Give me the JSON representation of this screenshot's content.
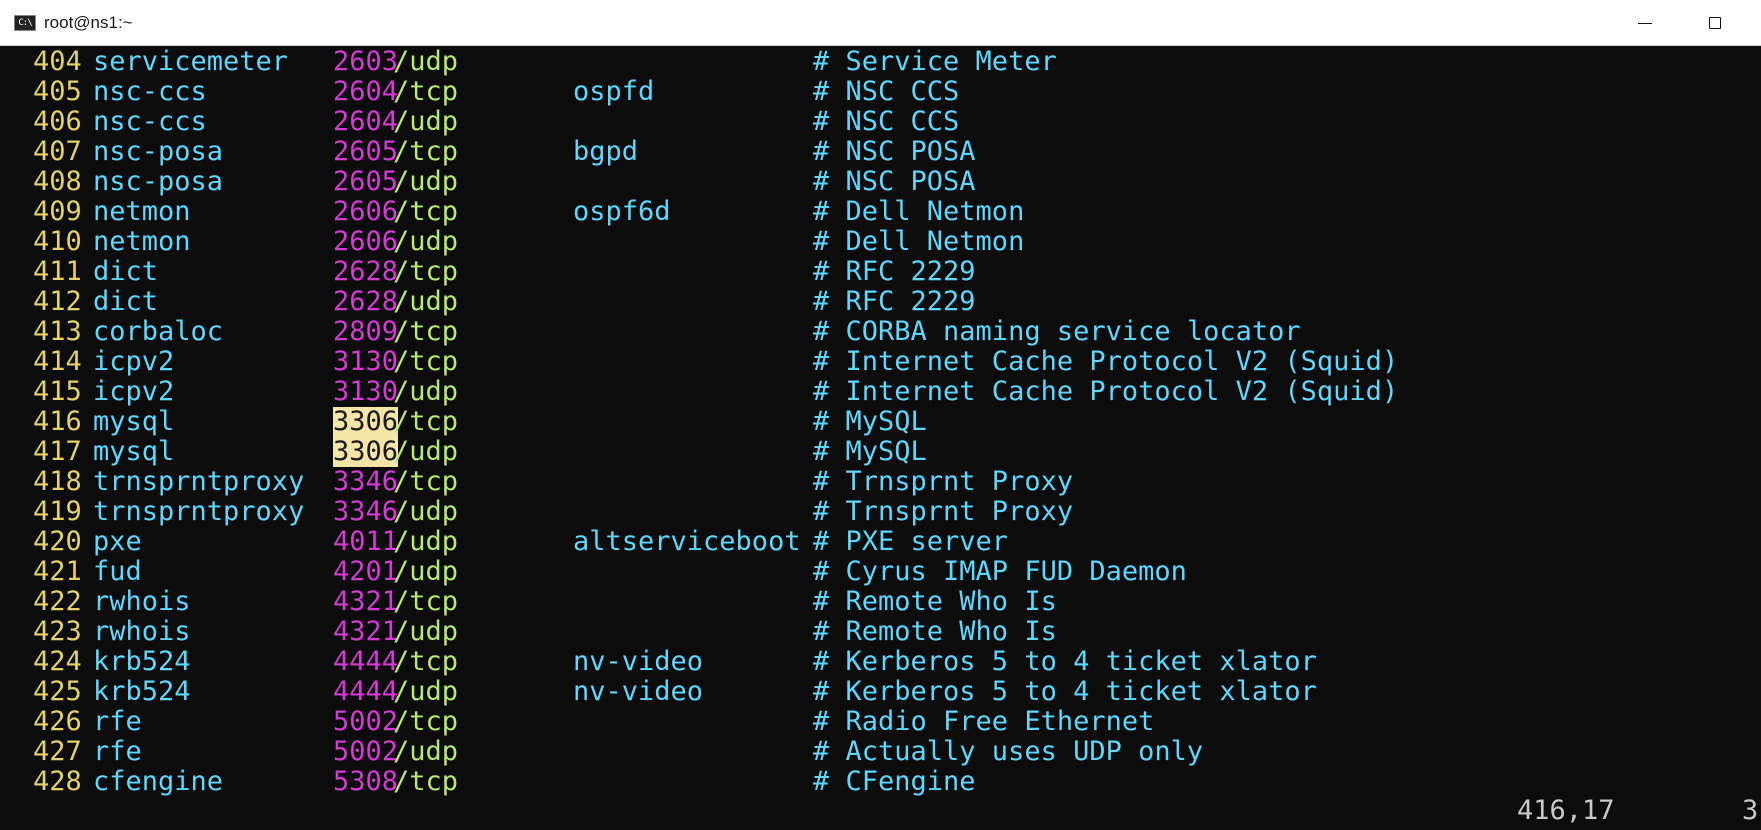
{
  "window": {
    "title": "root@ns1:~",
    "app_icon": "C:\\"
  },
  "colors": {
    "line_number": "#e3d26a",
    "service": "#5fd7ff",
    "port": "#d33bd3",
    "protocol": "#b5e876",
    "comment": "#5fd7ff",
    "search_highlight": "#f3e6a6"
  },
  "rows": [
    {
      "n": "404",
      "service": "servicemeter",
      "port": "2603",
      "proto": "/udp",
      "alias": "",
      "comment": "# Service Meter"
    },
    {
      "n": "405",
      "service": "nsc-ccs",
      "port": "2604",
      "proto": "/tcp",
      "alias": "ospfd",
      "comment": "# NSC CCS"
    },
    {
      "n": "406",
      "service": "nsc-ccs",
      "port": "2604",
      "proto": "/udp",
      "alias": "",
      "comment": "# NSC CCS"
    },
    {
      "n": "407",
      "service": "nsc-posa",
      "port": "2605",
      "proto": "/tcp",
      "alias": "bgpd",
      "comment": "# NSC POSA"
    },
    {
      "n": "408",
      "service": "nsc-posa",
      "port": "2605",
      "proto": "/udp",
      "alias": "",
      "comment": "# NSC POSA"
    },
    {
      "n": "409",
      "service": "netmon",
      "port": "2606",
      "proto": "/tcp",
      "alias": "ospf6d",
      "comment": "# Dell Netmon"
    },
    {
      "n": "410",
      "service": "netmon",
      "port": "2606",
      "proto": "/udp",
      "alias": "",
      "comment": "# Dell Netmon"
    },
    {
      "n": "411",
      "service": "dict",
      "port": "2628",
      "proto": "/tcp",
      "alias": "",
      "comment": "# RFC 2229"
    },
    {
      "n": "412",
      "service": "dict",
      "port": "2628",
      "proto": "/udp",
      "alias": "",
      "comment": "# RFC 2229"
    },
    {
      "n": "413",
      "service": "corbaloc",
      "port": "2809",
      "proto": "/tcp",
      "alias": "",
      "comment": "# CORBA naming service locator"
    },
    {
      "n": "414",
      "service": "icpv2",
      "port": "3130",
      "proto": "/tcp",
      "alias": "",
      "comment": "# Internet Cache Protocol V2 (Squid)"
    },
    {
      "n": "415",
      "service": "icpv2",
      "port": "3130",
      "proto": "/udp",
      "alias": "",
      "comment": "# Internet Cache Protocol V2 (Squid)"
    },
    {
      "n": "416",
      "service": "mysql",
      "port": "3306",
      "proto": "/tcp",
      "alias": "",
      "comment": "# MySQL",
      "highlight": true
    },
    {
      "n": "417",
      "service": "mysql",
      "port": "3306",
      "proto": "/udp",
      "alias": "",
      "comment": "# MySQL",
      "highlight": true
    },
    {
      "n": "418",
      "service": "trnsprntproxy",
      "port": "3346",
      "proto": "/tcp",
      "alias": "",
      "comment": "# Trnsprnt Proxy"
    },
    {
      "n": "419",
      "service": "trnsprntproxy",
      "port": "3346",
      "proto": "/udp",
      "alias": "",
      "comment": "# Trnsprnt Proxy"
    },
    {
      "n": "420",
      "service": "pxe",
      "port": "4011",
      "proto": "/udp",
      "alias": "altserviceboot",
      "comment": "# PXE server"
    },
    {
      "n": "421",
      "service": "fud",
      "port": "4201",
      "proto": "/udp",
      "alias": "",
      "comment": "# Cyrus IMAP FUD Daemon"
    },
    {
      "n": "422",
      "service": "rwhois",
      "port": "4321",
      "proto": "/tcp",
      "alias": "",
      "comment": "# Remote Who Is"
    },
    {
      "n": "423",
      "service": "rwhois",
      "port": "4321",
      "proto": "/udp",
      "alias": "",
      "comment": "# Remote Who Is"
    },
    {
      "n": "424",
      "service": "krb524",
      "port": "4444",
      "proto": "/tcp",
      "alias": "nv-video",
      "comment": "# Kerberos 5 to 4 ticket xlator"
    },
    {
      "n": "425",
      "service": "krb524",
      "port": "4444",
      "proto": "/udp",
      "alias": "nv-video",
      "comment": "# Kerberos 5 to 4 ticket xlator"
    },
    {
      "n": "426",
      "service": "rfe",
      "port": "5002",
      "proto": "/tcp",
      "alias": "",
      "comment": "# Radio Free Ethernet"
    },
    {
      "n": "427",
      "service": "rfe",
      "port": "5002",
      "proto": "/udp",
      "alias": "",
      "comment": "# Actually uses UDP only"
    },
    {
      "n": "428",
      "service": "cfengine",
      "port": "5308",
      "proto": "/tcp",
      "alias": "",
      "comment": "# CFengine"
    }
  ],
  "status": {
    "cursor_position": "416,17",
    "scroll_indicator": "3"
  }
}
